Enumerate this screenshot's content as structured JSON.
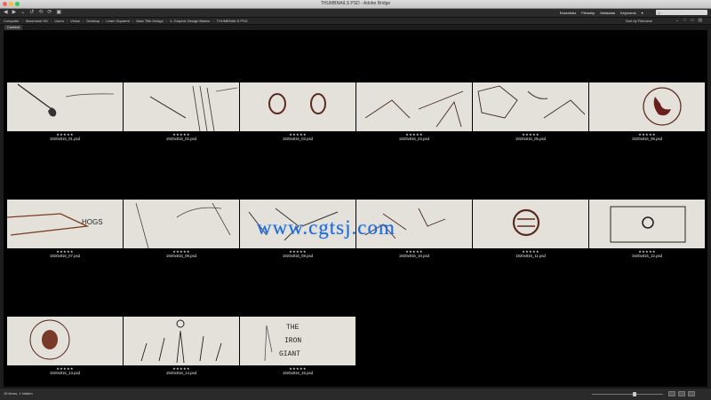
{
  "window": {
    "title": "THUMBNAILS PSD - Adobe Bridge",
    "traffic_colors": [
      "#fc605b",
      "#fdbc40",
      "#34c84a"
    ]
  },
  "toolbar": {
    "icons": [
      "back-icon",
      "forward-icon",
      "recent-icon",
      "boomerang-icon",
      "rotate-left-icon",
      "rotate-right-icon",
      "camera-icon"
    ],
    "workspaces": [
      "Essentials",
      "Filmstrip",
      "Metadata",
      "Keywords"
    ],
    "search_placeholder": "Q~"
  },
  "breadcrumbs": [
    "Computer",
    "Macintosh HD",
    "Users",
    "Vivian",
    "Desktop",
    "Learn Squared",
    "Main Title Design",
    "4. Graphic Design Basics",
    "THUMBNAILS PSD"
  ],
  "sort": {
    "label": "Sort by Filename"
  },
  "panel": {
    "tab_label": "Content"
  },
  "thumbnails": [
    {
      "file": "1920x816_01.psd",
      "rating": "★★★★★"
    },
    {
      "file": "1920x816_02.psd",
      "rating": "★★★★★"
    },
    {
      "file": "1920x816_03.psd",
      "rating": "★★★★★"
    },
    {
      "file": "1920x816_04.psd",
      "rating": "★★★★★"
    },
    {
      "file": "1920x816_05.psd",
      "rating": "★★★★★"
    },
    {
      "file": "1920x816_06.psd",
      "rating": "★★★★★"
    },
    {
      "file": "1920x816_07.psd",
      "rating": "★★★★★"
    },
    {
      "file": "1920x816_08.psd",
      "rating": "★★★★★"
    },
    {
      "file": "1920x816_09.psd",
      "rating": "★★★★★"
    },
    {
      "file": "1920x816_10.psd",
      "rating": "★★★★★"
    },
    {
      "file": "1920x816_11.psd",
      "rating": "★★★★★"
    },
    {
      "file": "1920x816_12.psd",
      "rating": "★★★★★"
    },
    {
      "file": "1920x816_13.psd",
      "rating": "★★★★★"
    },
    {
      "file": "1920x816_14.psd",
      "rating": "★★★★★"
    },
    {
      "file": "1920x816_15.psd",
      "rating": "★★★★★"
    }
  ],
  "sketch_text": {
    "hogs": "HOGS",
    "iron_giant": "THE IRON GIANT"
  },
  "watermark": "www.cgtsj.com",
  "status": {
    "text": "15 items, 1 hidden",
    "zoom_level": 0.6
  },
  "colors": {
    "accent": "#1e6bd6",
    "content_bg": "#000000"
  }
}
